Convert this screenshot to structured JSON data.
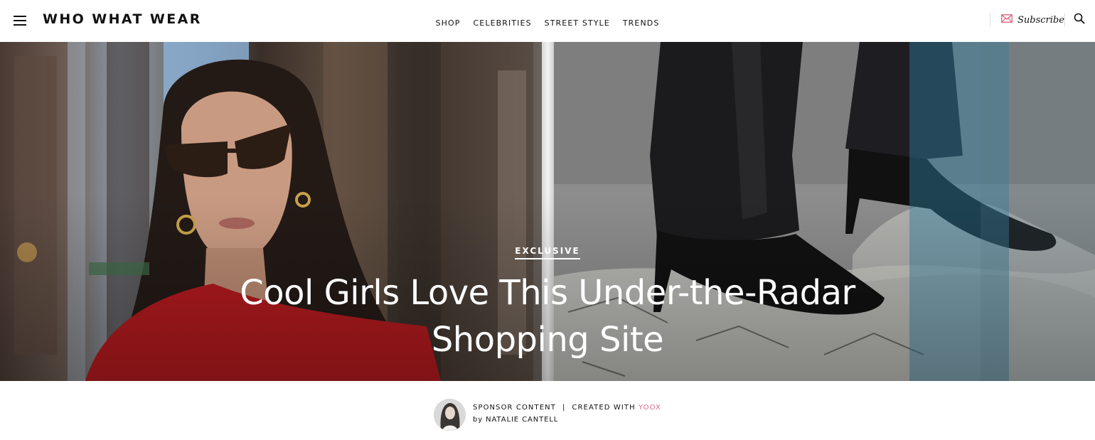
{
  "header": {
    "logo_text": "WHO WHAT WEAR",
    "nav": [
      {
        "label": "SHOP"
      },
      {
        "label": "CELEBRITIES"
      },
      {
        "label": "STREET STYLE"
      },
      {
        "label": "TRENDS"
      }
    ],
    "subscribe_label": "Subscribe",
    "icons": {
      "menu": "hamburger-menu-icon",
      "subscribe": "envelope-icon",
      "search": "search-icon"
    },
    "colors": {
      "subscribe_icon": "#e0607a"
    }
  },
  "hero": {
    "badge": "EXCLUSIVE",
    "headline": "Cool Girls Love This Under-the-Radar Shopping Site"
  },
  "byline": {
    "sponsor_label": "SPONSOR CONTENT",
    "separator": "|",
    "created_with_label": "CREATED WITH",
    "brand": "YOOX",
    "by_label": "by",
    "author": "NATALIE CANTELL",
    "colors": {
      "brand": "#d46a8a"
    }
  }
}
